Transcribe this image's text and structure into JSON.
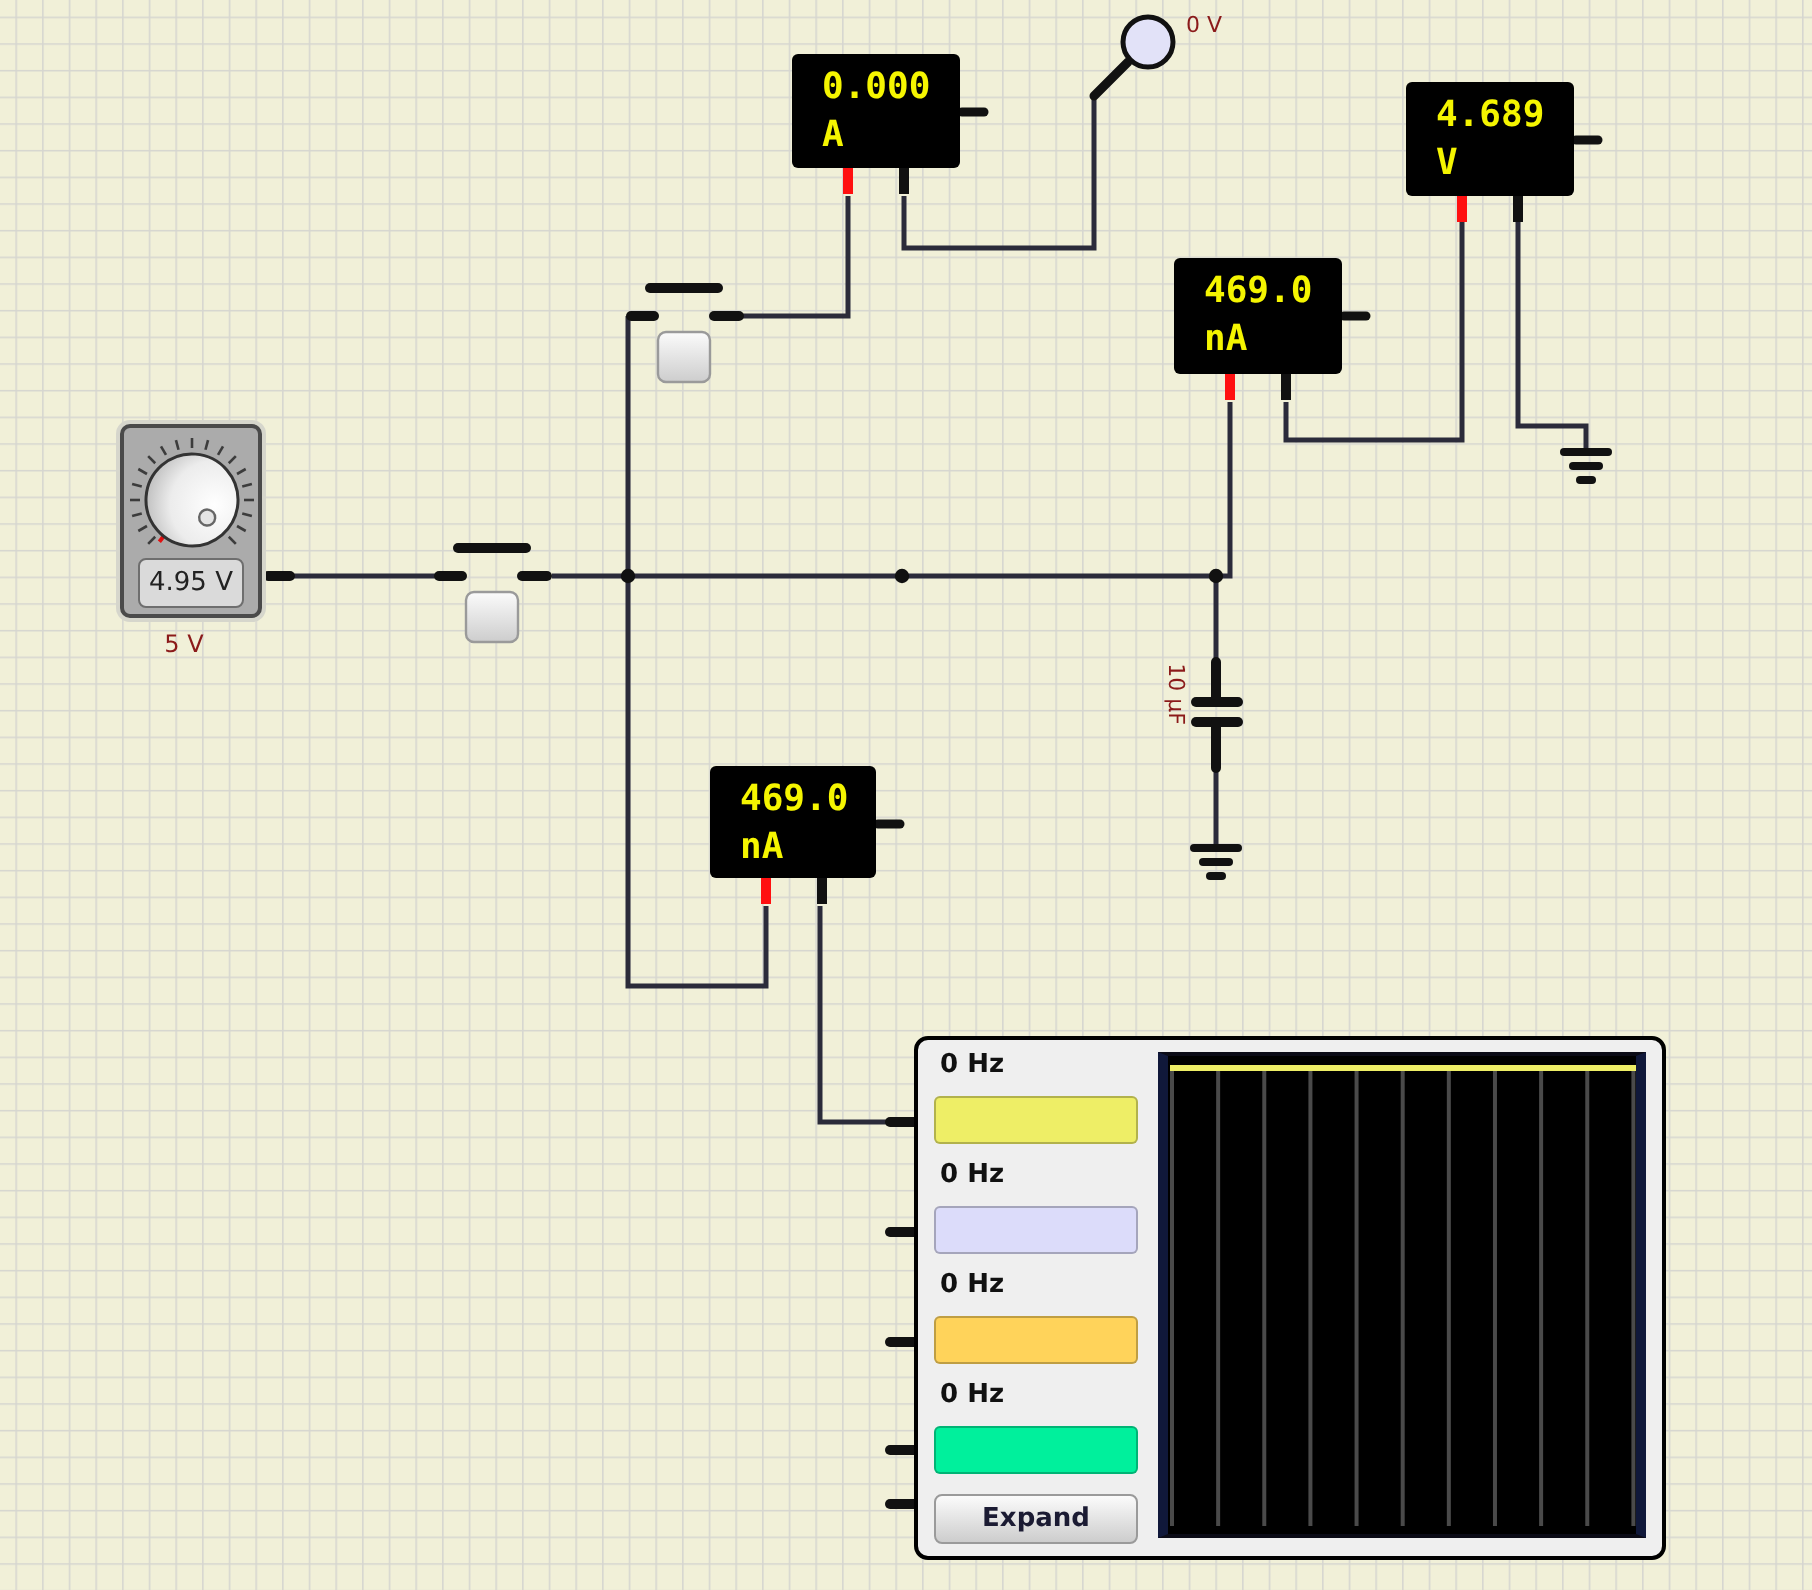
{
  "probe": {
    "reading": "0 V"
  },
  "meters": [
    {
      "reading": "0.000",
      "unit": "A"
    },
    {
      "reading": "4.689",
      "unit": "V"
    },
    {
      "reading": "469.0",
      "unit": "nA"
    },
    {
      "reading": "469.0",
      "unit": "nA"
    }
  ],
  "switches": [
    {
      "pressed": false
    },
    {
      "pressed": false
    }
  ],
  "power_supply": {
    "level": 0.99,
    "reading": "4.95 V",
    "label": "5 V"
  },
  "capacitor": {
    "label": "10 µF"
  },
  "oscilloscope": {
    "channels": [
      {
        "frequency": "0 Hz",
        "color": "#eeee66"
      },
      {
        "frequency": "0 Hz",
        "color": "#dcdcfa"
      },
      {
        "frequency": "0 Hz",
        "color": "#ffd35a"
      },
      {
        "frequency": "0 Hz",
        "color": "#00f09c"
      }
    ],
    "button": "Expand"
  }
}
